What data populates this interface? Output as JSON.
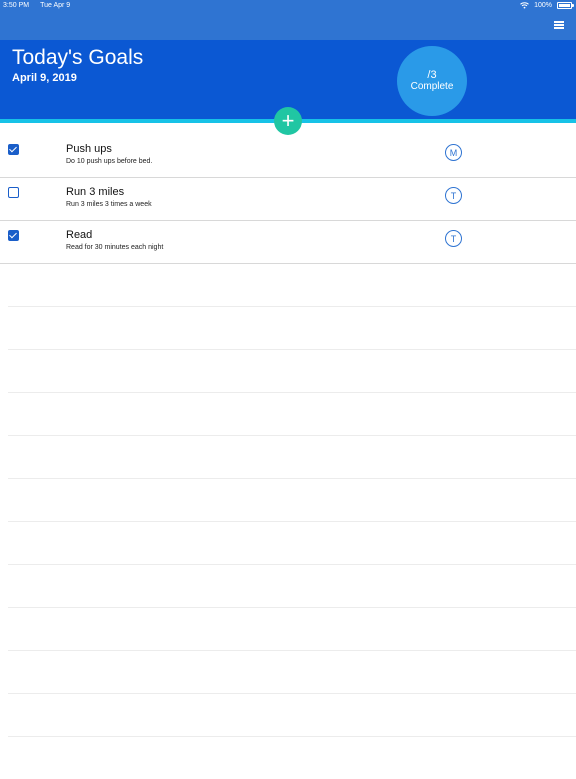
{
  "status_bar": {
    "time": "3:50 PM",
    "date": "Tue Apr 9",
    "battery": "100%"
  },
  "header": {
    "title": "Today's Goals",
    "date": "April 9, 2019",
    "progress_count": "/3",
    "progress_label": "Complete"
  },
  "add_button": {
    "label": "+"
  },
  "goals": [
    {
      "title": "Push ups",
      "description": "Do 10 push ups before bed.",
      "checked": true,
      "badge": "M"
    },
    {
      "title": "Run 3 miles",
      "description": "Run 3 miles 3 times a week",
      "checked": false,
      "badge": "T"
    },
    {
      "title": "Read",
      "description": "Read for 30 minutes each night",
      "checked": true,
      "badge": "T"
    }
  ],
  "icons": {
    "menu": "hamburger-menu-icon",
    "wifi": "wifi-icon",
    "battery": "battery-icon"
  },
  "colors": {
    "header": "#0b58d3",
    "status_bar": "#2f74d2",
    "accent_line": "#17c2e7",
    "progress_circle": "#2a9ae8",
    "add_button": "#20c6a3",
    "checkbox": "#1a5ec9"
  }
}
